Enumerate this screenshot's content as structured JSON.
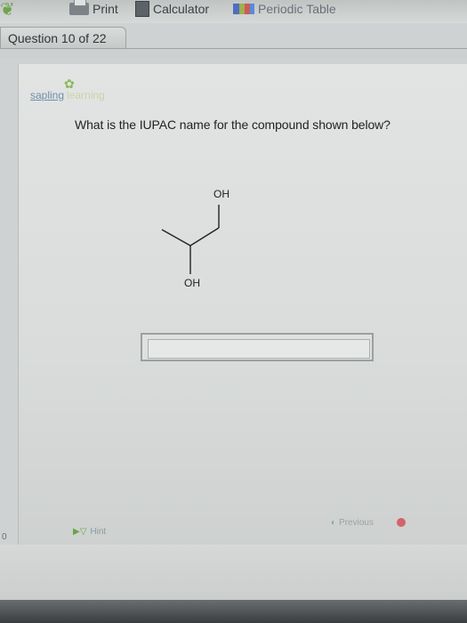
{
  "toolbar": {
    "print_label": "Print",
    "calculator_label": "Calculator",
    "periodic_label": "Periodic Table"
  },
  "question_tab": {
    "label": "Question 10 of 22"
  },
  "brand": {
    "sapling": "sapling",
    "learning": "learning"
  },
  "question": {
    "text": "What is the IUPAC name for the compound shown below?"
  },
  "molecule": {
    "top_label": "OH",
    "bottom_label": "OH"
  },
  "answer": {
    "value": "",
    "placeholder": ""
  },
  "footer": {
    "hint_label": "Hint",
    "previous_label": "Previous",
    "side_counter": "0"
  }
}
